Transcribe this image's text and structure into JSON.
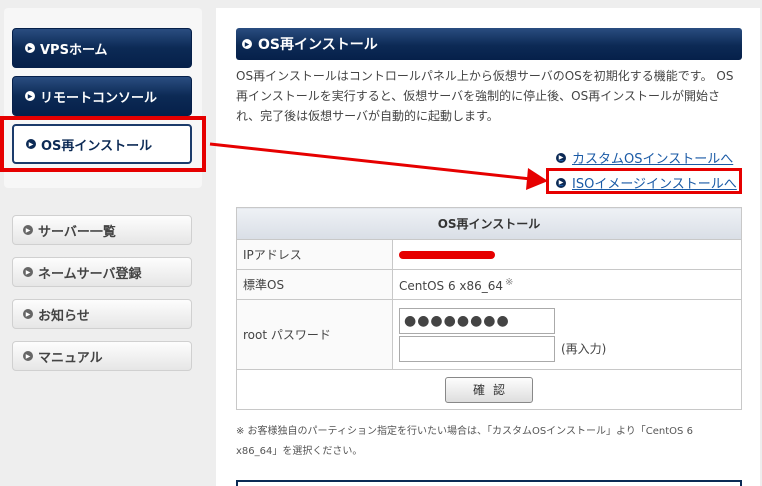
{
  "sidebar": {
    "primary": [
      {
        "label": "VPSホーム"
      },
      {
        "label": "リモートコンソール"
      },
      {
        "label": "OS再インストール"
      }
    ],
    "secondary": [
      {
        "label": "サーバー一覧"
      },
      {
        "label": "ネームサーバ登録"
      },
      {
        "label": "お知らせ"
      },
      {
        "label": "マニュアル"
      }
    ]
  },
  "main": {
    "title": "OS再インストール",
    "description": "OS再インストールはコントロールパネル上から仮想サーバのOSを初期化する機能です。 OS再インストールを実行すると、仮想サーバを強制的に停止後、OS再インストールが開始され、完了後は仮想サーバが自動的に起動します。",
    "links": {
      "custom": "カスタムOSインストールへ",
      "iso": "ISOイメージインストールへ"
    },
    "form": {
      "caption": "OS再インストール",
      "ip_label": "IPアドレス",
      "os_label": "標準OS",
      "os_value": "CentOS 6 x86_64",
      "os_note_mark": "※",
      "pw_label": "root パスワード",
      "pw_value": "●●●●●●●●",
      "pw_reenter_note": "(再入力)",
      "confirm_label": "確認"
    },
    "footnote": "※ お客様独自のパーティション指定を行いたい場合は、「カスタムOSインストール」より「CentOS 6 x86_64」を選択ください。"
  },
  "colors": {
    "nav_dark": "#0c2a55",
    "highlight_red": "#e60000",
    "link_blue": "#1a5aa6"
  }
}
